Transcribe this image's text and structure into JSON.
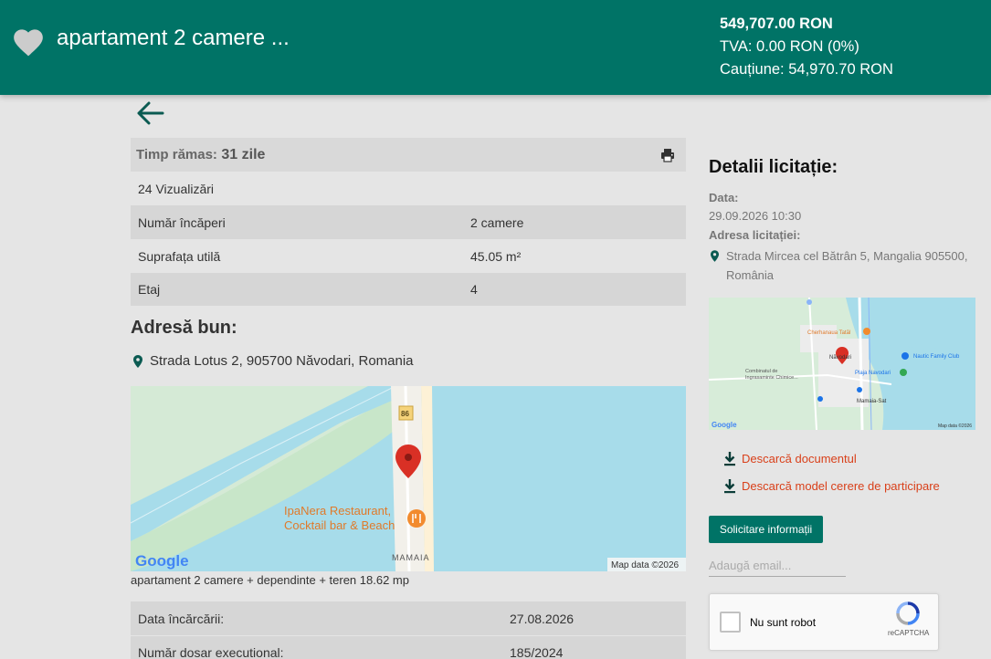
{
  "header": {
    "title": "apartament 2 camere ...",
    "price": "549,707.00 RON",
    "vat": "TVA: 0.00 RON (0%)",
    "deposit": "Cauțiune: 54,970.70 RON",
    "icons": {
      "favorite": "heart-icon"
    }
  },
  "nav": {
    "back_icon": "arrow-left-icon"
  },
  "summary": {
    "time_label": "Timp rămas:",
    "time_value": "31 zile",
    "views": "24 Vizualizări",
    "print_icon": "printer-icon"
  },
  "specs": [
    {
      "label": "Număr încăperi",
      "value": "2 camere"
    },
    {
      "label": "Suprafața utilă",
      "value": "45.05 m²"
    },
    {
      "label": "Etaj",
      "value": "4"
    }
  ],
  "address": {
    "heading": "Adresă bun:",
    "text": "Strada Lotus 2, 905700 Năvodari, Romania"
  },
  "map1": {
    "road_label": "86",
    "poi_line1": "IpaNera Restaurant,",
    "poi_line2": "Cocktail bar & Beach",
    "area_label": "MAMAIA",
    "brand": "Google",
    "attribution": "Map data ©2026"
  },
  "caption": "apartament 2 camere + dependinte + teren 18.62 mp",
  "details": [
    {
      "label": "Data încărcării:",
      "value": "27.08.2026"
    },
    {
      "label": "Număr dosar executional:",
      "value": "185/2024"
    }
  ],
  "auction": {
    "heading": "Detalii licitație:",
    "date_label": "Data:",
    "date_value": "29.09.2026 10:30",
    "address_label": "Adresa licitației:",
    "address_value": "Strada Mircea cel Bătrân 5, Mangalia 905500, România"
  },
  "map2": {
    "label1": "Cherhanaua Tatăl",
    "label2": "Năvodari",
    "label3": "Nautic Family Club",
    "label4": "Plaja Navodari",
    "label5": "Combinatul de",
    "label6": "Ingrasaminte Chimice...",
    "label7": "Mamaia-Sat",
    "brand": "Google",
    "attribution": "Map data ©2026"
  },
  "downloads": [
    {
      "label": "Descarcă documentul"
    },
    {
      "label": "Descarcă model cerere de participare"
    }
  ],
  "form": {
    "button_label": "Solicitare informații",
    "email_placeholder": "Adaugă email..."
  },
  "captcha": {
    "label": "Nu sunt robot",
    "brand": "reCAPTCHA"
  },
  "colors": {
    "primary": "#007366",
    "link": "#d9401a",
    "background": "#e5e5e5"
  }
}
